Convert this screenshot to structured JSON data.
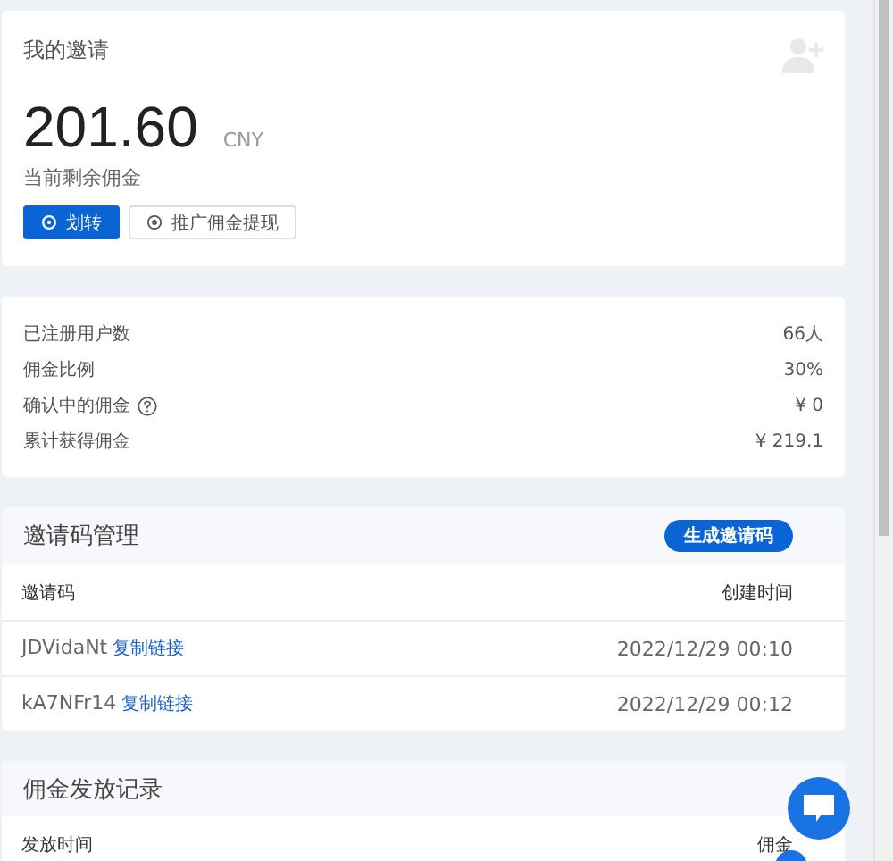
{
  "invite_card": {
    "title": "我的邀请",
    "amount": "201.60",
    "currency": "CNY",
    "caption": "当前剩余佣金",
    "buttons": [
      {
        "label": "划转",
        "kind": "primary"
      },
      {
        "label": "推广佣金提现",
        "kind": "default"
      }
    ]
  },
  "stats": [
    {
      "label": "已注册用户数",
      "value": "66人",
      "help": false
    },
    {
      "label": "佣金比例",
      "value": "30%",
      "help": false
    },
    {
      "label": "确认中的佣金",
      "value": "¥ 0",
      "help": true
    },
    {
      "label": "累计获得佣金",
      "value": "¥ 219.1",
      "help": false
    }
  ],
  "invite_codes": {
    "title": "邀请码管理",
    "action": "生成邀请码",
    "columns": [
      "邀请码",
      "创建时间"
    ],
    "rows": [
      {
        "code": "JDVidaNt",
        "link": "复制链接",
        "created": "2022/12/29 00:10"
      },
      {
        "code": "kA7NFr14",
        "link": "复制链接",
        "created": "2022/12/29 00:12"
      }
    ]
  },
  "payouts": {
    "title": "佣金发放记录",
    "columns": [
      "发放时间",
      "佣金"
    ]
  }
}
